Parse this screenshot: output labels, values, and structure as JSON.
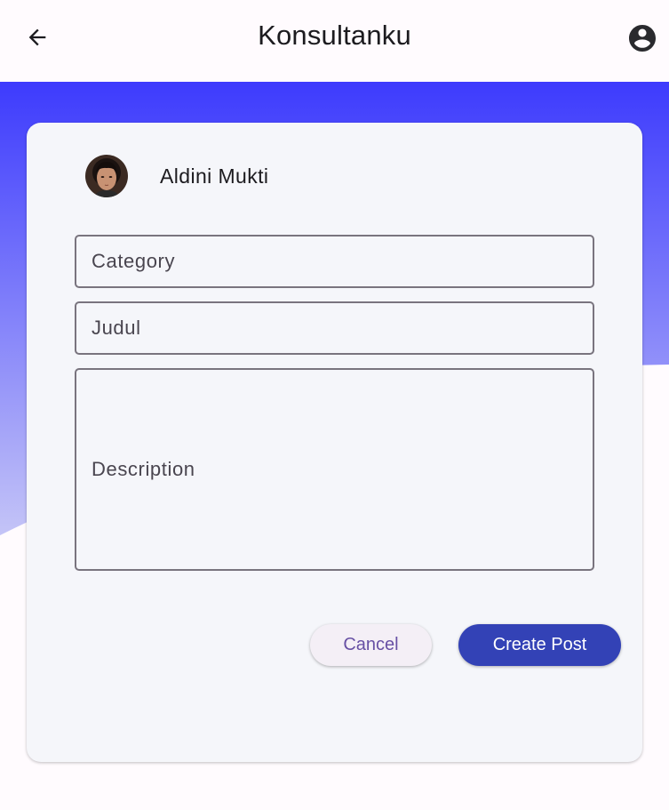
{
  "appbar": {
    "title": "Konsultanku",
    "back_icon": "arrow-back-icon",
    "profile_icon": "account-circle-icon"
  },
  "colors": {
    "gradient_top": "#3d3bfd",
    "gradient_bottom": "#b9b9f7",
    "card_bg": "#f5f6fa",
    "primary": "#3342b6",
    "cancel_text": "#6750a4"
  },
  "user": {
    "name": "Aldini Mukti",
    "avatar_icon": "user-avatar"
  },
  "form": {
    "category_label": "Category",
    "judul_label": "Judul",
    "description_label": "Description",
    "category_value": "",
    "judul_value": "",
    "description_value": ""
  },
  "actions": {
    "cancel_label": "Cancel",
    "create_label": "Create Post"
  }
}
